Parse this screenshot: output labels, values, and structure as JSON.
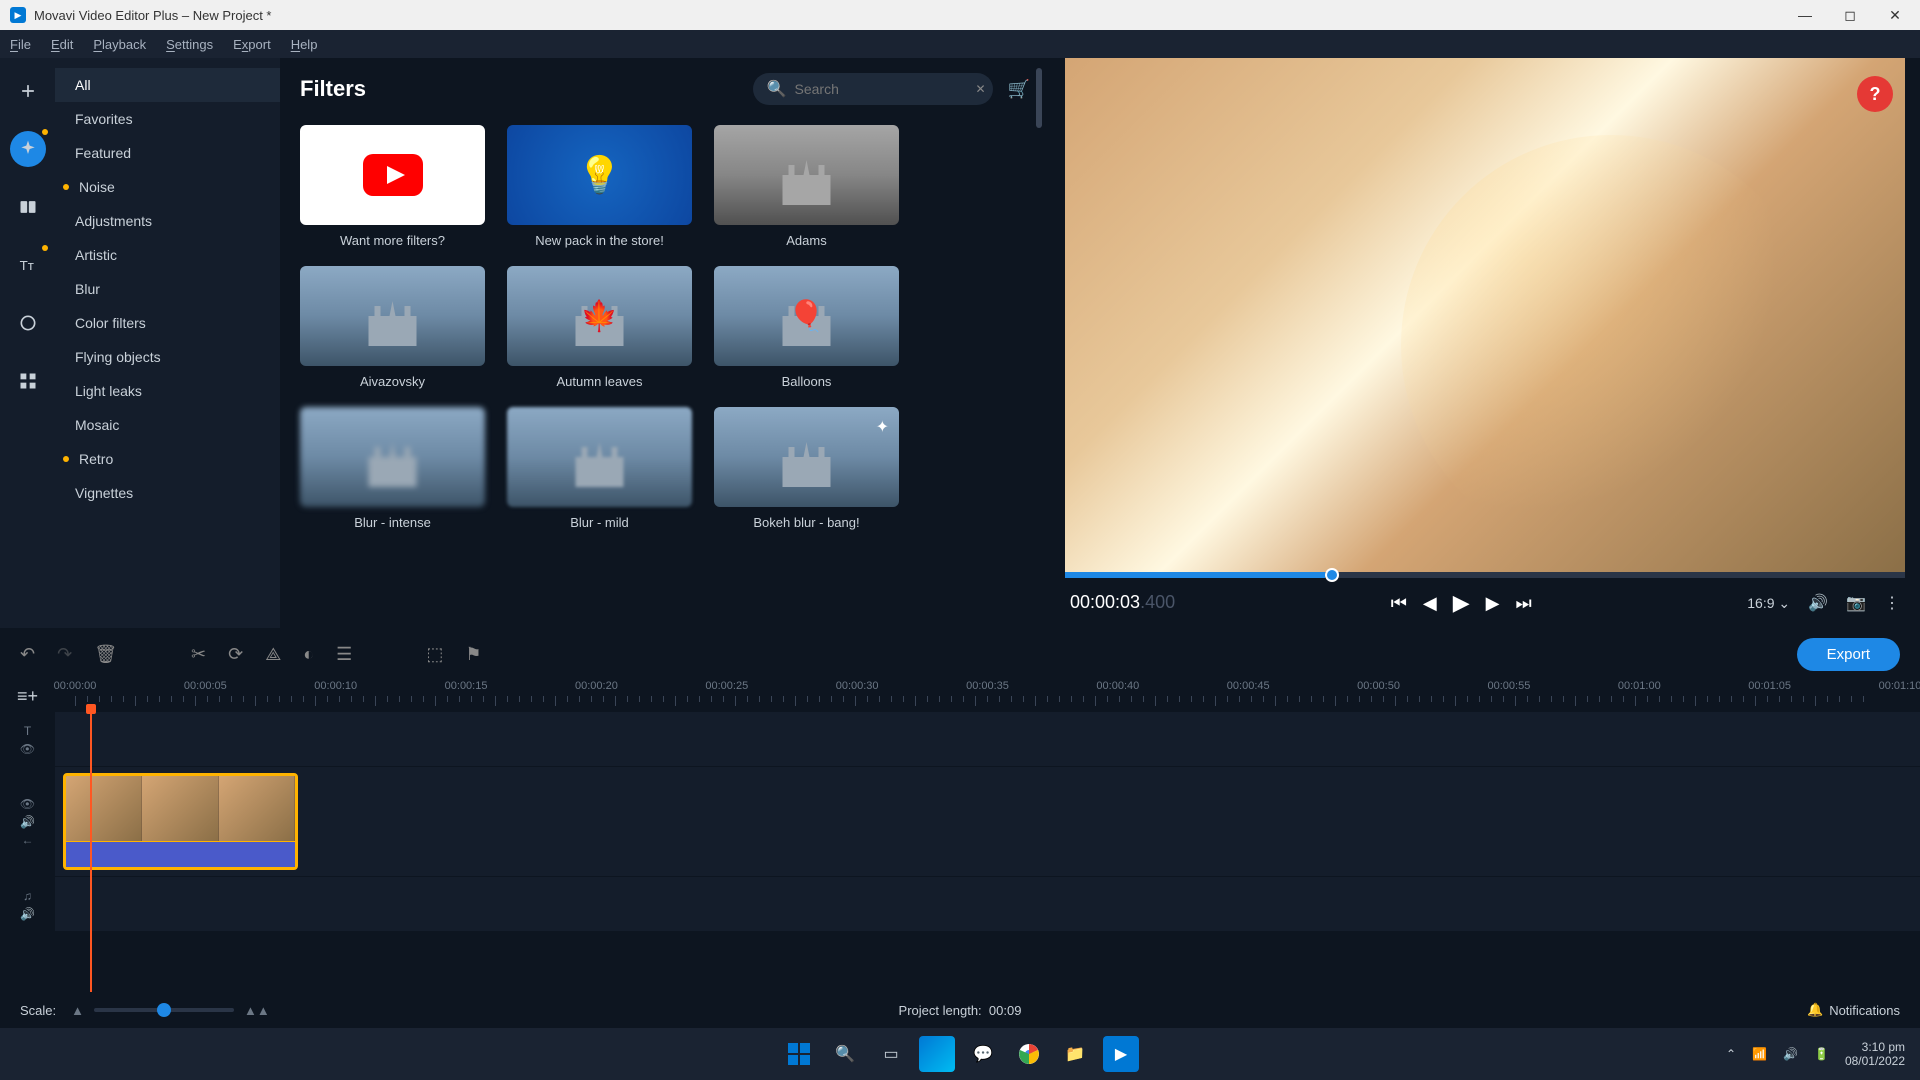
{
  "titlebar": {
    "title": "Movavi Video Editor Plus – New Project *"
  },
  "menubar": {
    "file": "File",
    "edit": "Edit",
    "playback": "Playback",
    "settings": "Settings",
    "export": "Export",
    "help": "Help"
  },
  "tools": {
    "add": "add",
    "filters": "filters",
    "transitions": "transitions",
    "titles": "titles",
    "stickers": "stickers",
    "more": "more"
  },
  "categories": [
    {
      "label": "All",
      "active": true,
      "dot": null
    },
    {
      "label": "Favorites",
      "active": false,
      "dot": null
    },
    {
      "label": "Featured",
      "active": false,
      "dot": null
    },
    {
      "label": "Noise",
      "active": false,
      "dot": "#ffb300"
    },
    {
      "label": "Adjustments",
      "active": false,
      "dot": null
    },
    {
      "label": "Artistic",
      "active": false,
      "dot": null
    },
    {
      "label": "Blur",
      "active": false,
      "dot": null
    },
    {
      "label": "Color filters",
      "active": false,
      "dot": null
    },
    {
      "label": "Flying objects",
      "active": false,
      "dot": null
    },
    {
      "label": "Light leaks",
      "active": false,
      "dot": null
    },
    {
      "label": "Mosaic",
      "active": false,
      "dot": null
    },
    {
      "label": "Retro",
      "active": false,
      "dot": "#ffb300"
    },
    {
      "label": "Vignettes",
      "active": false,
      "dot": null
    }
  ],
  "filtersPanel": {
    "title": "Filters",
    "searchPlaceholder": "Search",
    "items": [
      {
        "label": "Want more filters?",
        "kind": "promo-youtube"
      },
      {
        "label": "New pack in the store!",
        "kind": "promo-store"
      },
      {
        "label": "Adams",
        "kind": "castle-bw"
      },
      {
        "label": "Aivazovsky",
        "kind": "castle"
      },
      {
        "label": "Autumn leaves",
        "kind": "castle-leaf"
      },
      {
        "label": "Balloons",
        "kind": "castle-balloon"
      },
      {
        "label": "Blur - intense",
        "kind": "castle-blur"
      },
      {
        "label": "Blur - mild",
        "kind": "castle-blur-mild"
      },
      {
        "label": "Bokeh blur - bang!",
        "kind": "castle-bokeh"
      }
    ]
  },
  "preview": {
    "time_main": "00:00:03",
    "time_ms": ".400",
    "aspect": "16:9",
    "scrub_percent": 31
  },
  "timeline": {
    "export": "Export",
    "ruler": [
      "00:00:00",
      "00:00:05",
      "00:00:10",
      "00:00:15",
      "00:00:20",
      "00:00:25",
      "00:00:30",
      "00:00:35",
      "00:00:40",
      "00:00:45",
      "00:00:50",
      "00:00:55",
      "00:01:00",
      "00:01:05",
      "00:01:10"
    ],
    "scale_label": "Scale:",
    "project_length_label": "Project length:",
    "project_length_value": "00:09",
    "notifications": "Notifications"
  },
  "taskbar": {
    "time": "3:10 pm",
    "date": "08/01/2022"
  }
}
